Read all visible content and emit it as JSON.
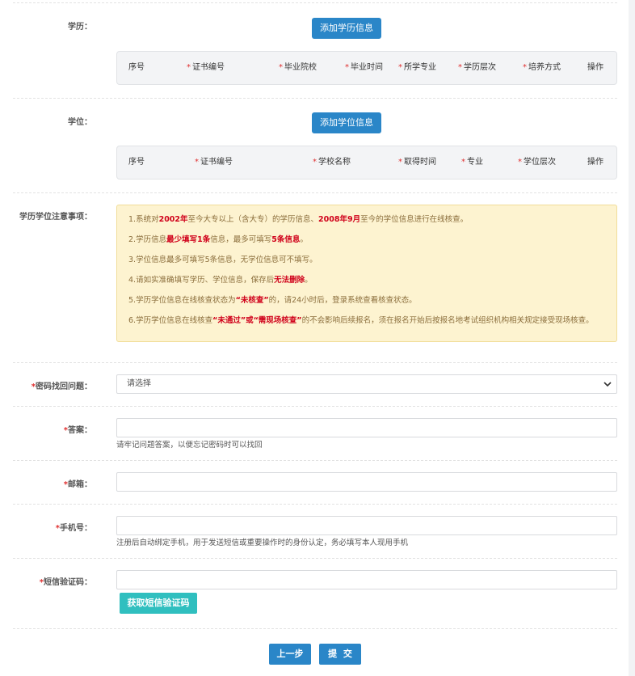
{
  "education": {
    "label": "学历：",
    "add_button": "添加学历信息",
    "columns": [
      {
        "text": "序号",
        "required": false
      },
      {
        "text": "证书编号",
        "required": true
      },
      {
        "text": "毕业院校",
        "required": true
      },
      {
        "text": "毕业时间",
        "required": true
      },
      {
        "text": "所学专业",
        "required": true
      },
      {
        "text": "学历层次",
        "required": true
      },
      {
        "text": "培养方式",
        "required": true
      },
      {
        "text": "操作",
        "required": false
      }
    ]
  },
  "degree": {
    "label": "学位：",
    "add_button": "添加学位信息",
    "columns": [
      {
        "text": "序号",
        "required": false
      },
      {
        "text": "证书编号",
        "required": true
      },
      {
        "text": "学校名称",
        "required": true
      },
      {
        "text": "取得时间",
        "required": true
      },
      {
        "text": "专业",
        "required": true
      },
      {
        "text": "学位层次",
        "required": true
      },
      {
        "text": "操作",
        "required": false
      }
    ]
  },
  "notice": {
    "label": "学历学位注意事项：",
    "lines": [
      [
        {
          "t": "1.系统对"
        },
        {
          "t": "2002年",
          "hl": true
        },
        {
          "t": "至今大专以上（含大专）的学历信息、"
        },
        {
          "t": "2008年9月",
          "hl": true
        },
        {
          "t": "至今的学位信息进行在线核查。"
        }
      ],
      [
        {
          "t": "2.学历信息"
        },
        {
          "t": "最少填写1条",
          "hl": true
        },
        {
          "t": "信息，最多可填写"
        },
        {
          "t": "5条信息",
          "hl": true
        },
        {
          "t": "。"
        }
      ],
      [
        {
          "t": "3.学位信息最多可填写5条信息，无学位信息可不填写。"
        }
      ],
      [
        {
          "t": "4.请如实准确填写学历、学位信息，保存后"
        },
        {
          "t": "无法删除",
          "hl": true
        },
        {
          "t": "。"
        }
      ],
      [
        {
          "t": "5.学历学位信息在线核查状态为"
        },
        {
          "t": "“未核查”",
          "hl": true
        },
        {
          "t": "的，请24小时后，登录系统查看核查状态。"
        }
      ],
      [
        {
          "t": "6.学历学位信息在线核查"
        },
        {
          "t": "“未通过”或“需现场核查”",
          "hl": true
        },
        {
          "t": "的不会影响后续报名，须在报名开始后按报名地考试组织机构相关规定接受现场核查。"
        }
      ]
    ]
  },
  "security_question": {
    "label": "密码找回问题：",
    "selected": "请选择"
  },
  "answer": {
    "label": "答案：",
    "value": "",
    "hint": "请牢记问题答案，以便忘记密码时可以找回"
  },
  "email": {
    "label": "邮箱：",
    "value": ""
  },
  "phone": {
    "label": "手机号：",
    "value": "",
    "hint": "注册后自动绑定手机，用于发送短信或重要操作时的身份认定，务必填写本人现用手机"
  },
  "sms": {
    "label": "短信验证码：",
    "value": "",
    "get_code_button": "获取短信验证码"
  },
  "actions": {
    "prev": "上一步",
    "submit": "提  交"
  }
}
